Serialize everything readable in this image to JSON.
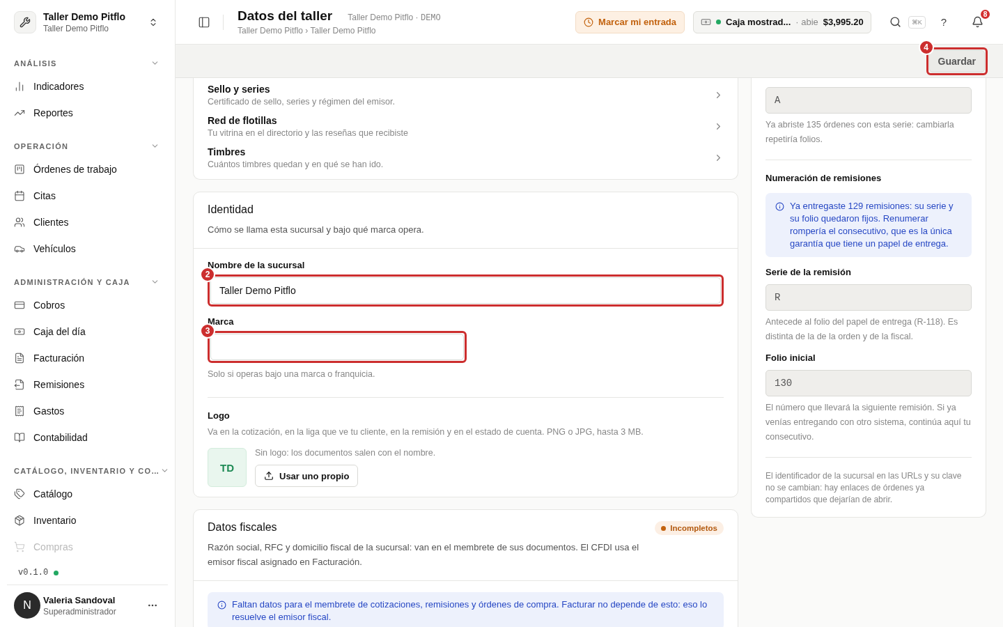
{
  "workspace": {
    "name": "Taller Demo Pitflo",
    "subtitle": "Taller Demo Pitflo"
  },
  "sidebar": {
    "sections": [
      {
        "title": "ANÁLISIS",
        "expanded": true,
        "items": [
          {
            "label": "Indicadores",
            "selected": false
          },
          {
            "label": "Reportes",
            "selected": false
          }
        ]
      },
      {
        "title": "OPERACIÓN",
        "expanded": true,
        "items": [
          {
            "label": "Órdenes de trabajo",
            "selected": false
          },
          {
            "label": "Citas",
            "selected": false
          },
          {
            "label": "Clientes",
            "selected": false
          },
          {
            "label": "Vehículos",
            "selected": false
          }
        ]
      },
      {
        "title": "ADMINISTRACIÓN Y CAJA",
        "expanded": true,
        "items": [
          {
            "label": "Cobros",
            "selected": false
          },
          {
            "label": "Caja del día",
            "selected": false
          },
          {
            "label": "Facturación",
            "selected": false
          },
          {
            "label": "Remisiones",
            "selected": false
          },
          {
            "label": "Gastos",
            "selected": false
          },
          {
            "label": "Contabilidad",
            "selected": false
          }
        ]
      },
      {
        "title": "CATÁLOGO, INVENTARIO Y CO…",
        "expanded": true,
        "items": [
          {
            "label": "Catálogo",
            "selected": false
          },
          {
            "label": "Inventario",
            "selected": false
          },
          {
            "label": "Compras",
            "selected": false,
            "faded": true
          }
        ]
      }
    ],
    "version": "v0.1.0",
    "online": true,
    "user": {
      "initial": "N",
      "name": "Valeria Sandoval",
      "role": "Superadministrador"
    }
  },
  "header": {
    "title": "Datos del taller",
    "context": "Taller Demo Pitflo",
    "context_sep": "·",
    "tag": "DEMO",
    "breadcrumb": [
      "Taller Demo Pitflo",
      "›",
      "Taller Demo Pitflo"
    ],
    "checkin_button": "Marcar mi entrada",
    "register": {
      "name": "Caja mostrad...",
      "sep": "·",
      "status": "abie",
      "open": true,
      "amount": "$3,995.20"
    },
    "shortcut": "⌘K",
    "help": "?",
    "notifications": "8"
  },
  "toolbar": {
    "save_button": "Guardar",
    "callout": "4"
  },
  "settings_links": [
    {
      "title": "Sello y series",
      "description": "Certificado de sello, series y régimen del emisor."
    },
    {
      "title": "Red de flotillas",
      "description": "Tu vitrina en el directorio y las reseñas que recibiste"
    },
    {
      "title": "Timbres",
      "description": "Cuántos timbres quedan y en qué se han ido."
    }
  ],
  "identity": {
    "title": "Identidad",
    "description": "Cómo se llama esta sucursal y bajo qué marca opera.",
    "fields": [
      {
        "label": "Nombre de la sucursal",
        "value": "Taller Demo Pitflo",
        "callout": "2",
        "wide": true
      },
      {
        "label": "Marca",
        "callout": "3",
        "wide": false,
        "help": "Solo si operas bajo una marca o franquicia."
      }
    ],
    "logo": {
      "label": "Logo",
      "description": "Va en la cotización, en la liga que ve tu cliente, en la remisión y en el estado de cuenta. PNG o JPG, hasta 3 MB.",
      "initials": "TD",
      "status": "Sin logo: los documentos salen con el nombre.",
      "button": "Usar uno propio"
    }
  },
  "fiscal": {
    "title": "Datos fiscales",
    "badge": "Incompletos",
    "description": "Razón social, RFC y domicilio fiscal de la sucursal: van en el membrete de sus documentos. El CFDI usa el emisor fiscal asignado en Facturación.",
    "notice": "Faltan datos para el membrete de cotizaciones, remisiones y órdenes de compra. Facturar no depende de esto: eso lo resuelve el emisor fiscal."
  },
  "numbering": {
    "blocks": [
      {
        "kind": "field",
        "value": "A",
        "disabled": true,
        "help": "Ya abriste 135 órdenes con esta serie: cambiarla repetiría folios."
      },
      {
        "kind": "divider"
      },
      {
        "kind": "heading",
        "text": "Numeración de remisiones"
      },
      {
        "kind": "notice",
        "text": "Ya entregaste 129 remisiones: su serie y su folio quedaron fijos. Renumerar rompería el consecutivo, que es la única garantía que tiene un papel de entrega."
      },
      {
        "kind": "field",
        "label": "Serie de la remisión",
        "value": "R",
        "disabled": true,
        "help": "Antecede al folio del papel de entrega (R-118). Es distinta de la de la orden y de la fiscal."
      },
      {
        "kind": "field",
        "label": "Folio inicial",
        "value": "130",
        "disabled": true,
        "help": "El número que llevará la siguiente remisión. Si ya venías entregando con otro sistema, continúa aquí tu consecutivo."
      },
      {
        "kind": "divider"
      },
      {
        "kind": "note",
        "text": "El identificador de la sucursal en las URLs y su clave no se cambian: hay enlaces de órdenes ya compartidos que dejarían de abrir."
      }
    ]
  }
}
